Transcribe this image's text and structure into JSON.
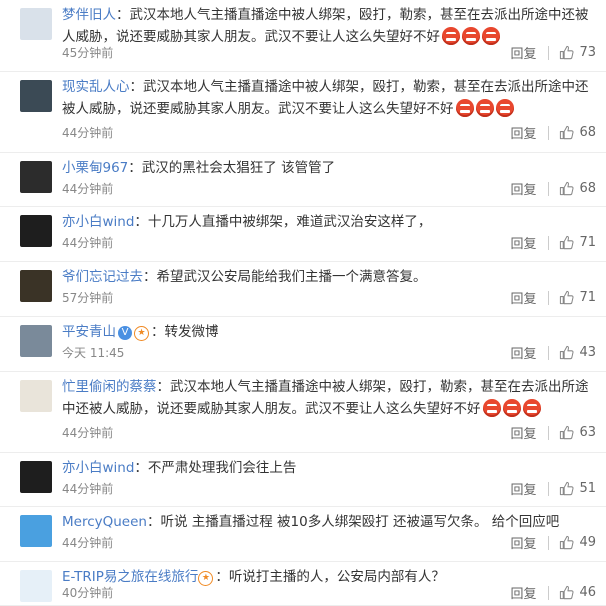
{
  "reply_label": "回复",
  "comments": [
    {
      "user": "梦伴旧人",
      "sep": "：",
      "text": "武汉本地人气主播直播途中被人绑架，殴打，勒索，甚至在去派出所途中还被人威胁，说还要威胁其家人朋友。武汉不要让人这么失望好不好",
      "emojis": 3,
      "time": "45分钟前",
      "likes": "73",
      "avatar_color": "#d9e1ea"
    },
    {
      "user": "现实乱人心",
      "sep": "：",
      "text": "武汉本地人气主播直播途中被人绑架，殴打，勒索，甚至在去派出所途中还被人威胁，说还要威胁其家人朋友。武汉不要让人这么失望好不好",
      "emojis": 3,
      "time": "44分钟前",
      "likes": "68",
      "avatar_color": "#3b4a55"
    },
    {
      "user": "小栗甸967",
      "sep": "：",
      "text": "武汉的黑社会太猖狂了 该管管了",
      "emojis": 0,
      "time": "44分钟前",
      "likes": "68",
      "avatar_color": "#2c2c2c"
    },
    {
      "user": "亦小白wind",
      "sep": "：",
      "text": "十几万人直播中被绑架，难道武汉治安这样了，",
      "emojis": 0,
      "time": "44分钟前",
      "likes": "71",
      "avatar_color": "#1e1e1e"
    },
    {
      "user": "爷们忘记过去",
      "sep": "：",
      "text": "希望武汉公安局能给我们主播一个满意答复。",
      "emojis": 0,
      "time": "57分钟前",
      "likes": "71",
      "avatar_color": "#3a3326"
    },
    {
      "user": "平安青山",
      "sep": "：",
      "text": "转发微博",
      "emojis": 0,
      "time": "今天 11:45",
      "likes": "43",
      "avatar_color": "#7a8a9a",
      "verified": true
    },
    {
      "user": "忙里偷闲的蔡蔡",
      "sep": "：",
      "text": "武汉本地人气主播直播途中被人绑架，殴打，勒索，甚至在去派出所途中还被人威胁，说还要威胁其家人朋友。武汉不要让人这么失望好不好",
      "emojis": 3,
      "time": "44分钟前",
      "likes": "63",
      "avatar_color": "#e9e4da"
    },
    {
      "user": "亦小白wind",
      "sep": "：",
      "text": "不严肃处理我们会往上告",
      "emojis": 0,
      "time": "44分钟前",
      "likes": "51",
      "avatar_color": "#1e1e1e"
    },
    {
      "user": "MercyQueen",
      "sep": "：",
      "text": "听说 主播直播过程 被10多人绑架殴打 还被逼写欠条。 给个回应吧",
      "emojis": 0,
      "time": "44分钟前",
      "likes": "49",
      "avatar_color": "#4aa0e0"
    },
    {
      "user": "E-TRIP易之旅在线旅行",
      "sep": "：",
      "text": "听说打主播的人，公安局内部有人？",
      "emojis": 0,
      "time": "40分钟前",
      "likes": "46",
      "avatar_color": "#e6f0f8",
      "org": true
    }
  ]
}
